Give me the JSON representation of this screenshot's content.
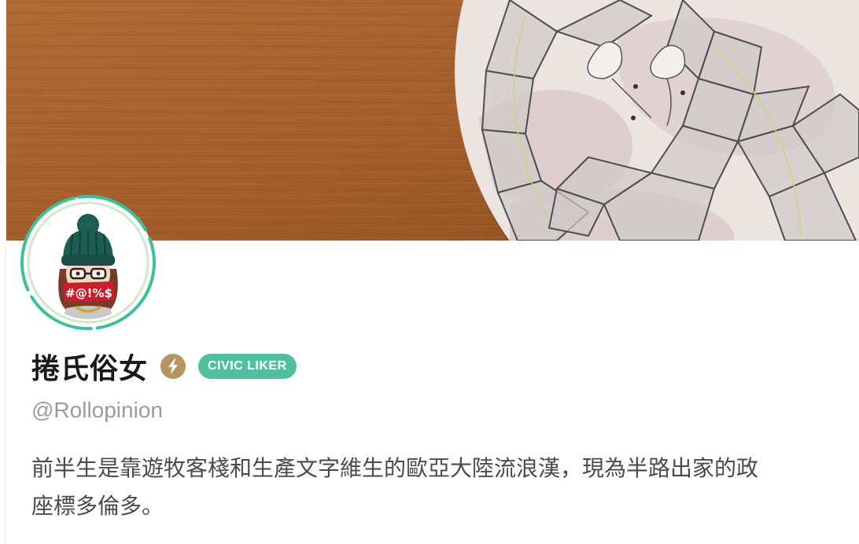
{
  "profile": {
    "display_name": "捲氏俗女",
    "handle": "@Rollopinion",
    "badge_label": "CIVIC LIKER",
    "bio_line_1": "前半生是靠遊牧客棧和生產文字維生的歐亞大陸流浪漢，現為半路出家的政",
    "bio_line_2": "座標多倫多。",
    "avatar_text": "#@!%$"
  },
  "colors": {
    "civic_badge": "#50c0a0",
    "lightning_badge": "#b4955f",
    "avatar_ring": "#3cbf9c",
    "name_text": "#1a1a1a",
    "handle_text": "#9b9b9b",
    "bio_text": "#4a4a4a"
  },
  "icons": {
    "lightning": "lightning-icon",
    "avatar": "avatar-illustration"
  }
}
